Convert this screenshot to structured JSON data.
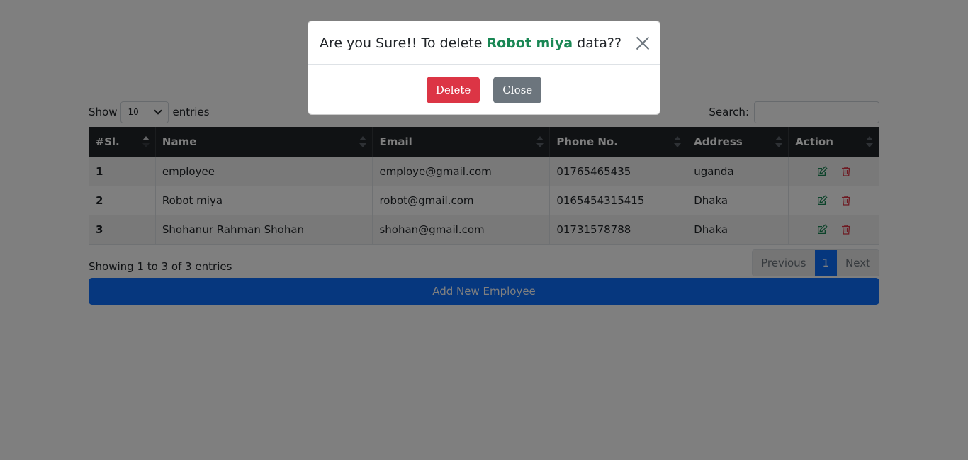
{
  "modal": {
    "title_prefix": "Are you Sure!! To delete ",
    "title_name": "Robot miya",
    "title_suffix": " data??",
    "delete_label": "Delete",
    "close_label": "Close"
  },
  "controls": {
    "show_label": "Show",
    "entries_label": "entries",
    "page_length": "10",
    "search_label": "Search:"
  },
  "table": {
    "headers": [
      "#Sl.",
      "Name",
      "Email",
      "Phone No.",
      "Address",
      "Action"
    ],
    "rows": [
      {
        "sl": "1",
        "name": "employee",
        "email": "employe@gmail.com",
        "phone": "01765465435",
        "address": "uganda"
      },
      {
        "sl": "2",
        "name": "Robot miya",
        "email": "robot@gmail.com",
        "phone": "0165454315415",
        "address": "Dhaka"
      },
      {
        "sl": "3",
        "name": "Shohanur Rahman Shohan",
        "email": "shohan@gmail.com",
        "phone": "01731578788",
        "address": "Dhaka"
      }
    ]
  },
  "footer": {
    "info": "Showing 1 to 3 of 3 entries",
    "prev_label": "Previous",
    "current_page": "1",
    "next_label": "Next",
    "add_label": "Add New Employee"
  },
  "colors": {
    "primary": "#0d6efd",
    "danger": "#dc3545",
    "secondary": "#6c757d",
    "success": "#198754",
    "table_head": "#212529"
  },
  "icons": [
    "edit-icon",
    "trash-icon",
    "close-icon",
    "chevron-down-icon",
    "sort-icon"
  ]
}
